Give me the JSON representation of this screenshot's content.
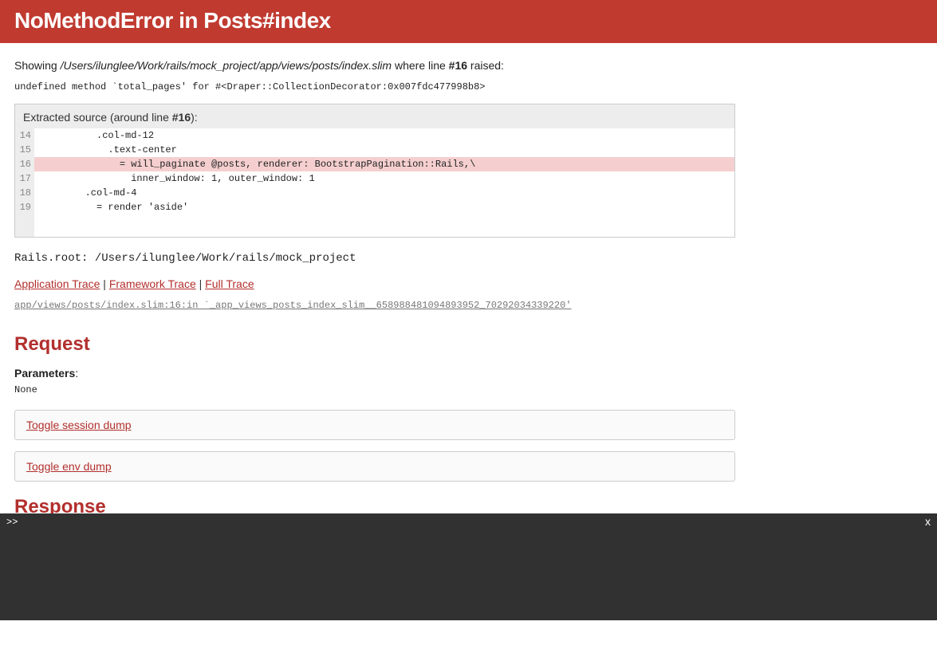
{
  "header": {
    "title": "NoMethodError in Posts#index"
  },
  "showing": {
    "prefix": "Showing ",
    "file_path": "/Users/ilunglee/Work/rails/mock_project/app/views/posts/index.slim",
    "mid": " where line ",
    "line_ref": "#16",
    "suffix": " raised:"
  },
  "exception_message": "undefined method `total_pages' for #<Draper::CollectionDecorator:0x007fdc477998b8>",
  "extracted": {
    "label_prefix": "Extracted source (around line ",
    "line_ref": "#16",
    "label_suffix": "):",
    "lines": [
      {
        "n": "14",
        "code": "          .col-md-12",
        "hl": false
      },
      {
        "n": "15",
        "code": "            .text-center",
        "hl": false
      },
      {
        "n": "16",
        "code": "              = will_paginate @posts, renderer: BootstrapPagination::Rails,\\",
        "hl": true
      },
      {
        "n": "17",
        "code": "                inner_window: 1, outer_window: 1",
        "hl": false
      },
      {
        "n": "18",
        "code": "        .col-md-4",
        "hl": false
      },
      {
        "n": "19",
        "code": "          = render 'aside'",
        "hl": false
      }
    ]
  },
  "rails_root": "Rails.root: /Users/ilunglee/Work/rails/mock_project",
  "trace_links": {
    "app": "Application Trace",
    "framework": "Framework Trace",
    "full": "Full Trace",
    "sep": " | "
  },
  "trace_line": "app/views/posts/index.slim:16:in `_app_views_posts_index_slim__658988481094893952_70292034339220'",
  "request": {
    "heading": "Request",
    "params_label": "Parameters",
    "params_colon": ":",
    "params_value": "None",
    "toggle_session": "Toggle session dump",
    "toggle_env": "Toggle env dump"
  },
  "response": {
    "heading": "Response"
  },
  "console": {
    "prompt": ">>",
    "close": "x"
  }
}
